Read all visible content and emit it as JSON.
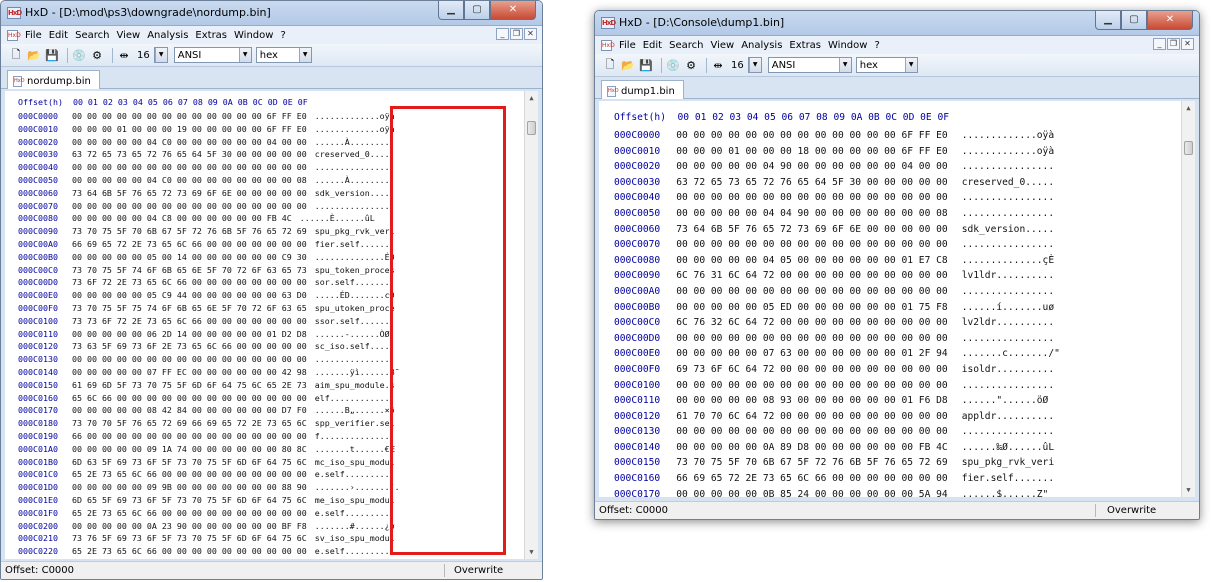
{
  "menu": [
    "File",
    "Edit",
    "Search",
    "View",
    "Analysis",
    "Extras",
    "Window",
    "?"
  ],
  "toolbar": {
    "bytes_per_row": "16",
    "charset": "ANSI",
    "mode": "hex"
  },
  "status_mode": "Overwrite",
  "windows": [
    {
      "title": "HxD - [D:\\mod\\ps3\\downgrade\\nordump.bin]",
      "tab": "nordump.bin",
      "hex_header": "Offset(h)  00 01 02 03 04 05 06 07 08 09 0A 0B 0C 0D 0E 0F",
      "status_offset": "Offset: C0000",
      "rows": [
        [
          "000C0000",
          "00 00 00 00 00 00 00 00 00 00 00 00 00 6F FF E0",
          ".............oÿà"
        ],
        [
          "000C0010",
          "00 00 00 01 00 00 00 19 00 00 00 00 00 6F FF E0",
          ".............oÿà"
        ],
        [
          "000C0020",
          "00 00 00 00 00 04 C0 00 00 00 00 00 00 04 00 00",
          "......À........."
        ],
        [
          "000C0030",
          "63 72 65 73 65 72 76 65 64 5F 30 00 00 00 00 00",
          "creserved_0....."
        ],
        [
          "000C0040",
          "00 00 00 00 00 00 00 00 00 00 00 00 00 00 00 00",
          "................"
        ],
        [
          "000C0050",
          "00 00 00 00 00 04 C0 00 00 00 00 00 00 00 00 08",
          "......À........."
        ],
        [
          "000C0060",
          "73 64 6B 5F 76 65 72 73 69 6F 6E 00 00 00 00 00",
          "sdk_version....."
        ],
        [
          "000C0070",
          "00 00 00 00 00 00 00 00 00 00 00 00 00 00 00 00",
          "................"
        ],
        [
          "000C0080",
          "00 00 00 00 00 04 C8 00 00 00 00 00 00 FB 4C",
          "......È......ûL"
        ],
        [
          "000C0090",
          "73 70 75 5F 70 6B 67 5F 72 76 6B 5F 76 65 72 69",
          "spu_pkg_rvk_veri"
        ],
        [
          "000C00A0",
          "66 69 65 72 2E 73 65 6C 66 00 00 00 00 00 00 00",
          "fier.self......."
        ],
        [
          "000C00B0",
          "00 00 00 00 00 05 00 14 00 00 00 00 00 00 C9 30",
          "..............É0"
        ],
        [
          "000C00C0",
          "73 70 75 5F 74 6F 6B 65 6E 5F 70 72 6F 63 65 73",
          "spu_token_proces"
        ],
        [
          "000C00D0",
          "73 6F 72 2E 73 65 6C 66 00 00 00 00 00 00 00 00",
          "sor.self........"
        ],
        [
          "000C00E0",
          "00 00 00 00 00 05 C9 44 00 00 00 00 00 00 63 D0",
          ".....ÉD.......cÐ"
        ],
        [
          "000C00F0",
          "73 70 75 5F 75 74 6F 6B 65 6E 5F 70 72 6F 63 65",
          "spu_utoken_proce"
        ],
        [
          "000C0100",
          "73 73 6F 72 2E 73 65 6C 66 00 00 00 00 00 00 00",
          "ssor.self......."
        ],
        [
          "000C0110",
          "00 00 00 00 00 06 2D 14 00 00 00 00 00 01 D2 D8",
          "......-......ÒØ"
        ],
        [
          "000C0120",
          "73 63 5F 69 73 6F 2E 73 65 6C 66 00 00 00 00 00",
          "sc_iso.self....."
        ],
        [
          "000C0130",
          "00 00 00 00 00 00 00 00 00 00 00 00 00 00 00 00",
          "................"
        ],
        [
          "000C0140",
          "00 00 00 00 00 07 FF EC 00 00 00 00 00 00 42 98",
          ".......ÿì......B˜"
        ],
        [
          "000C0150",
          "61 69 6D 5F 73 70 75 5F 6D 6F 64 75 6C 65 2E 73",
          "aim_spu_module.s"
        ],
        [
          "000C0160",
          "65 6C 66 00 00 00 00 00 00 00 00 00 00 00 00 00",
          "elf............."
        ],
        [
          "000C0170",
          "00 00 00 00 00 08 42 84 00 00 00 00 00 00 D7 F0",
          "......B„......×ð"
        ],
        [
          "000C0180",
          "73 70 70 5F 76 65 72 69 66 69 65 72 2E 73 65 6C",
          "spp_verifier.sel"
        ],
        [
          "000C0190",
          "66 00 00 00 00 00 00 00 00 00 00 00 00 00 00 00",
          "f..............."
        ],
        [
          "000C01A0",
          "00 00 00 00 00 09 1A 74 00 00 00 00 00 00 80 8C",
          ".......t......€Œ"
        ],
        [
          "000C01B0",
          "6D 63 5F 69 73 6F 5F 73 70 75 5F 6D 6F 64 75 6C",
          "mc_iso_spu_modul"
        ],
        [
          "000C01C0",
          "65 2E 73 65 6C 66 00 00 00 00 00 00 00 00 00 00",
          "e.self.........."
        ],
        [
          "000C01D0",
          "00 00 00 00 00 09 9B 00 00 00 00 00 00 00 88 90",
          ".......›.......ˆ."
        ],
        [
          "000C01E0",
          "6D 65 5F 69 73 6F 5F 73 70 75 5F 6D 6F 64 75 6C",
          "me_iso_spu_modul"
        ],
        [
          "000C01F0",
          "65 2E 73 65 6C 66 00 00 00 00 00 00 00 00 00 00",
          "e.self.........."
        ],
        [
          "000C0200",
          "00 00 00 00 00 0A 23 90 00 00 00 00 00 00 BF F8",
          ".......#......¿ø"
        ],
        [
          "000C0210",
          "73 76 5F 69 73 6F 5F 73 70 75 5F 6D 6F 64 75 6C",
          "sv_iso_spu_modul"
        ],
        [
          "000C0220",
          "65 2E 73 65 6C 66 00 00 00 00 00 00 00 00 00 00",
          "e.self.........."
        ]
      ]
    },
    {
      "title": "HxD - [D:\\Console\\dump1.bin]",
      "tab": "dump1.bin",
      "hex_header": "Offset(h)  00 01 02 03 04 05 06 07 08 09 0A 0B 0C 0D 0E 0F",
      "status_offset": "Offset: C0000",
      "rows": [
        [
          "000C0000",
          "00 00 00 00 00 00 00 00 00 00 00 00 00 6F FF E0",
          ".............oÿà"
        ],
        [
          "000C0010",
          "00 00 00 01 00 00 00 18 00 00 00 00 00 6F FF E0",
          ".............oÿà"
        ],
        [
          "000C0020",
          "00 00 00 00 00 04 90 00 00 00 00 00 00 04 00 00",
          "................"
        ],
        [
          "000C0030",
          "63 72 65 73 65 72 76 65 64 5F 30 00 00 00 00 00",
          "creserved_0....."
        ],
        [
          "000C0040",
          "00 00 00 00 00 00 00 00 00 00 00 00 00 00 00 00",
          "................"
        ],
        [
          "000C0050",
          "00 00 00 00 00 04 04 90 00 00 00 00 00 00 00 08",
          "................"
        ],
        [
          "000C0060",
          "73 64 6B 5F 76 65 72 73 69 6F 6E 00 00 00 00 00",
          "sdk_version....."
        ],
        [
          "000C0070",
          "00 00 00 00 00 00 00 00 00 00 00 00 00 00 00 00",
          "................"
        ],
        [
          "000C0080",
          "00 00 00 00 00 04 05 00 00 00 00 00 00 01 E7 C8",
          "..............çÈ"
        ],
        [
          "000C0090",
          "6C 76 31 6C 64 72 00 00 00 00 00 00 00 00 00 00",
          "lv1ldr.........."
        ],
        [
          "000C00A0",
          "00 00 00 00 00 00 00 00 00 00 00 00 00 00 00 00",
          "................"
        ],
        [
          "000C00B0",
          "00 00 00 00 00 05 ED 00 00 00 00 00 00 01 75 F8",
          "......í.......uø"
        ],
        [
          "000C00C0",
          "6C 76 32 6C 64 72 00 00 00 00 00 00 00 00 00 00",
          "lv2ldr.........."
        ],
        [
          "000C00D0",
          "00 00 00 00 00 00 00 00 00 00 00 00 00 00 00 00",
          "................"
        ],
        [
          "000C00E0",
          "00 00 00 00 00 07 63 00 00 00 00 00 00 01 2F 94",
          ".......c......./\""
        ],
        [
          "000C00F0",
          "69 73 6F 6C 64 72 00 00 00 00 00 00 00 00 00 00",
          "isoldr.........."
        ],
        [
          "000C0100",
          "00 00 00 00 00 00 00 00 00 00 00 00 00 00 00 00",
          "................"
        ],
        [
          "000C0110",
          "00 00 00 00 00 08 93 00 00 00 00 00 00 01 F6 D8",
          "......\"......öØ"
        ],
        [
          "000C0120",
          "61 70 70 6C 64 72 00 00 00 00 00 00 00 00 00 00",
          "appldr.........."
        ],
        [
          "000C0130",
          "00 00 00 00 00 00 00 00 00 00 00 00 00 00 00 00",
          "................"
        ],
        [
          "000C0140",
          "00 00 00 00 00 0A 89 D8 00 00 00 00 00 00 FB 4C",
          "......‰Ø......ûL"
        ],
        [
          "000C0150",
          "73 70 75 5F 70 6B 67 5F 72 76 6B 5F 76 65 72 69",
          "spu_pkg_rvk_veri"
        ],
        [
          "000C0160",
          "66 69 65 72 2E 73 65 6C 66 00 00 00 00 00 00 00",
          "fier.self......."
        ],
        [
          "000C0170",
          "00 00 00 00 00 0B 85 24 00 00 00 00 00 00 5A 94",
          "......$......Z\""
        ],
        [
          "000C0180",
          "73 70 75 5F 74 6F 6B 65 6E 5F 70 72 6F 63 65 73",
          "spu_token_proces"
        ]
      ]
    }
  ]
}
